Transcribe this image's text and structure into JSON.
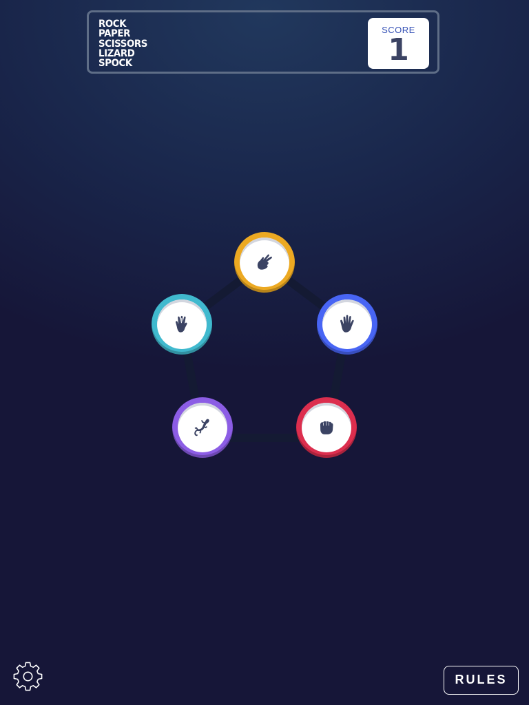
{
  "header": {
    "title_lines": [
      "ROCK",
      "PAPER",
      "SCISSORS",
      "LIZARD",
      "SPOCK"
    ],
    "score_label": "SCORE",
    "score_value": "1"
  },
  "choices": [
    {
      "name": "scissors",
      "color": "#eca922",
      "icon": "scissors-icon"
    },
    {
      "name": "paper",
      "color": "#4865f4",
      "icon": "paper-icon"
    },
    {
      "name": "rock",
      "color": "#dc2e4e",
      "icon": "rock-icon"
    },
    {
      "name": "lizard",
      "color": "#8c5de5",
      "icon": "lizard-icon"
    },
    {
      "name": "spock",
      "color": "#40b9ce",
      "icon": "spock-icon"
    }
  ],
  "footer": {
    "rules_label": "RULES",
    "settings_icon": "gear-icon"
  },
  "colors": {
    "background_top": "#21385d",
    "background_bottom": "#161638",
    "header_border": "#5f6e87",
    "score_text": "#3450b5",
    "score_value": "#3b4363",
    "icon_fill": "#3b4363"
  }
}
